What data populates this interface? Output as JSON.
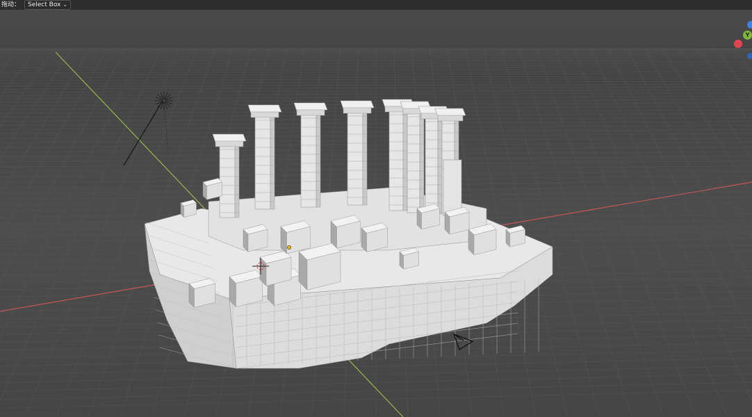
{
  "header": {
    "drag_label": "拖动：",
    "select_mode": "Select Box"
  },
  "gizmo": {
    "axis_y_label": "Y",
    "axis_colors": {
      "x": "#e2464e",
      "y": "#7db83a",
      "z": "#3e82e6"
    }
  },
  "icons": {
    "dropdown": "chevron-down-icon",
    "light": "sun-lamp-icon",
    "camera": "camera-icon",
    "cursor": "3d-cursor-icon",
    "origin": "object-origin-icon"
  },
  "colors": {
    "background": "#474747",
    "grid": "#5a5a5a",
    "axis_x": "#c45656",
    "axis_y": "#9bb84a",
    "mesh_top": "#e8e8e8",
    "mesh_side": "#cfcfcf",
    "mesh_shadow": "#a9a9a9"
  }
}
